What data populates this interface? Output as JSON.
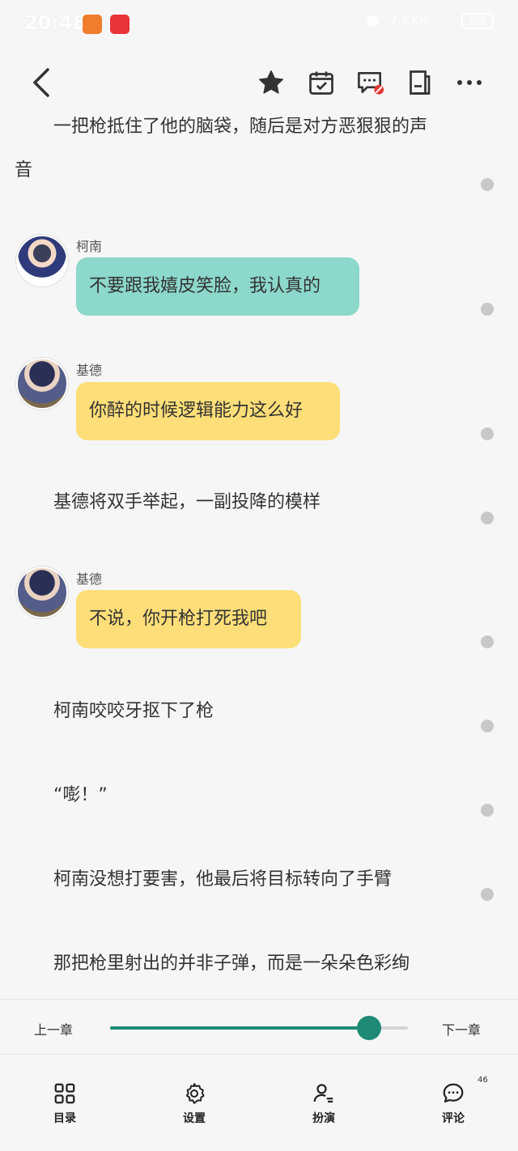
{
  "status_bar": {
    "time": "20:48",
    "speed": "7.7 K/s",
    "battery": "100"
  },
  "toolbar": {
    "back_icon": "chevron-left-icon",
    "icons": [
      "star-icon",
      "calendar-check-icon",
      "comment-off-icon",
      "bookmark-icon",
      "more-icon"
    ]
  },
  "content": {
    "p1_line1": "一把枪抵住了他的脑袋，随后是对方恶狠狠的声",
    "p1_line2": "音",
    "msg1": {
      "speaker": "柯南",
      "text": "不要跟我嬉皮笑脸，我认真的"
    },
    "msg2": {
      "speaker": "基德",
      "text": "你醉的时候逻辑能力这么好"
    },
    "p2": "基德将双手举起，一副投降的模样",
    "msg3": {
      "speaker": "基德",
      "text": "不说，你开枪打死我吧"
    },
    "p3": "柯南咬咬牙抠下了枪",
    "p4": "“嘭！”",
    "p5": "柯南没想打要害，他最后将目标转向了手臂",
    "p6": "那把枪里射出的并非子弹，而是一朵朵色彩绚"
  },
  "bottom": {
    "prev_chapter": "上一章",
    "next_chapter": "下一章",
    "progress": 0.87,
    "nav": [
      {
        "label": "目录",
        "icon": "grid-icon"
      },
      {
        "label": "设置",
        "icon": "gear-icon"
      },
      {
        "label": "扮演",
        "icon": "user-edit-icon"
      },
      {
        "label": "评论",
        "icon": "comment-icon"
      }
    ],
    "comment_count": "46"
  },
  "colors": {
    "accent": "#1e8a76",
    "bubble_teal": "#8cd8cb",
    "bubble_yellow": "#fede78",
    "background": "#f6f6f6"
  }
}
